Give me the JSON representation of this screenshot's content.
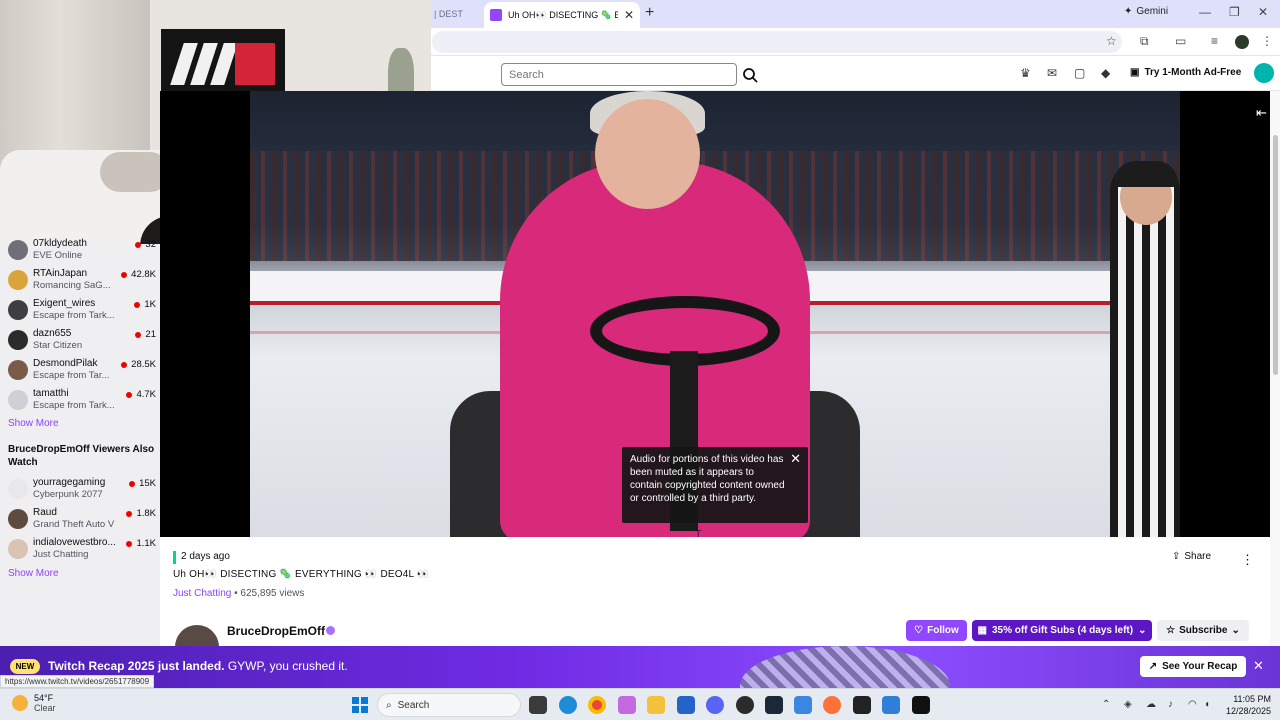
{
  "browser": {
    "prev_tab_title": "| DEST",
    "active_tab_title": "Uh OH👀 DISECTING 🦠 EVER",
    "gemini_label": "Gemini"
  },
  "twitch_header": {
    "search_placeholder": "Search",
    "ad_free_label": "Try 1-Month Ad-Free"
  },
  "sidebar": {
    "followed": [
      {
        "name": "07kldydeath",
        "game": "EVE Online",
        "viewers": "32",
        "avatar_color": "#6f6f7a"
      },
      {
        "name": "RTAinJapan",
        "game": "Romancing SaG...",
        "viewers": "42.8K",
        "avatar_color": "#d9a53a"
      },
      {
        "name": "Exigent_wires",
        "game": "Escape from Tark...",
        "viewers": "1K",
        "avatar_color": "#3e3e42"
      },
      {
        "name": "dazn655",
        "game": "Star Citizen",
        "viewers": "21",
        "avatar_color": "#2b2b2b"
      },
      {
        "name": "DesmondPilak",
        "game": "Escape from Tar...",
        "viewers": "28.5K",
        "avatar_color": "#7a5a48"
      },
      {
        "name": "tamatthi",
        "game": "Escape from Tark...",
        "viewers": "4.7K",
        "avatar_color": "#cfcfd6"
      }
    ],
    "show_more_1": "Show More",
    "also_watch_title": "BruceDropEmOff Viewers Also Watch",
    "also_watch": [
      {
        "name": "yourragegaming",
        "game": "Cyberpunk 2077",
        "viewers": "15K",
        "avatar_color": "#e8e8ea"
      },
      {
        "name": "Raud",
        "game": "Grand Theft Auto V",
        "viewers": "1.8K",
        "avatar_color": "#5e4a3e"
      },
      {
        "name": "indialovewestbro...",
        "game": "Just Chatting",
        "viewers": "1.1K",
        "avatar_color": "#d9c4b4"
      }
    ],
    "show_more_2": "Show More"
  },
  "player": {
    "muted_notice": "Audio for portions of this video has been muted as it appears to contain copyrighted content owned or controlled by a third party."
  },
  "video_info": {
    "posted": "2 days ago",
    "title": "Uh OH👀 DISECTING 🦠 EVERYTHING 👀 DEO4L 👀",
    "category": "Just Chatting",
    "views": " • 625,895 views",
    "share_label": "Share",
    "streamer": "BruceDropEmOff",
    "follow_label": "Follow",
    "gift_label": "35% off Gift Subs (4 days left)",
    "subscribe_label": "Subscribe"
  },
  "recap_banner": {
    "badge": "NEW",
    "headline": "Twitch Recap 2025 just landed.",
    "subtext": " GYWP, you crushed it.",
    "button": "See Your Recap"
  },
  "status_url": "https://www.twitch.tv/videos/2651778909",
  "taskbar": {
    "temperature": "54°F",
    "condition": "Clear",
    "search_label": "Search",
    "time": "11:05 PM",
    "date": "12/28/2025"
  },
  "colors": {
    "twitch_purple": "#9147ff",
    "live_red": "#eb0400",
    "gift_purple": "#5c16c5"
  }
}
